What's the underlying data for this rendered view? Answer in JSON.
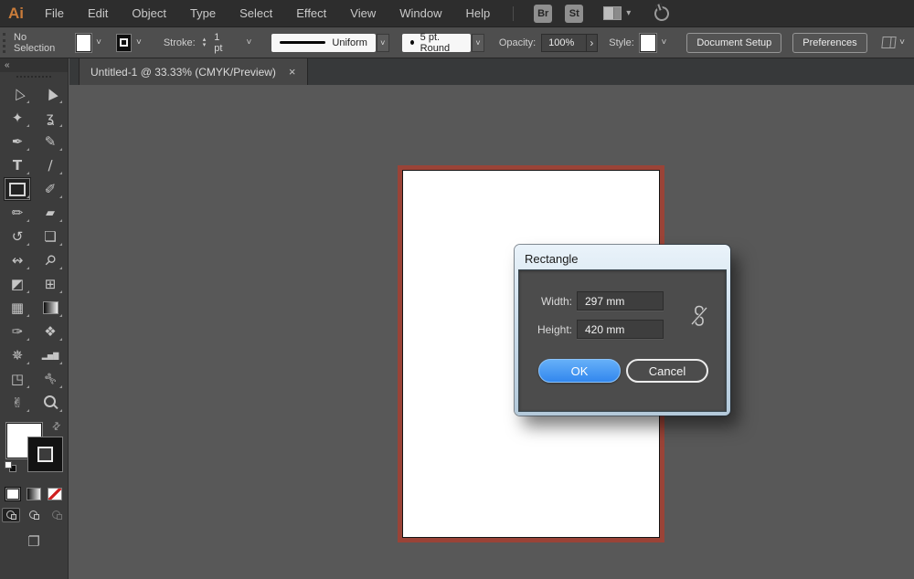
{
  "menubar": {
    "logo": "Ai",
    "items": [
      "File",
      "Edit",
      "Object",
      "Type",
      "Select",
      "Effect",
      "View",
      "Window",
      "Help"
    ],
    "bridge_badge": "Br",
    "stock_badge": "St"
  },
  "optionsbar": {
    "selection_status": "No Selection",
    "stroke_label": "Stroke:",
    "stroke_weight": "1 pt",
    "width_profile": "Uniform",
    "brush_definition": "5 pt. Round",
    "opacity_label": "Opacity:",
    "opacity_value": "100%",
    "style_label": "Style:",
    "document_setup_label": "Document Setup",
    "preferences_label": "Preferences"
  },
  "tabbar": {
    "title": "Untitled-1 @ 33.33% (CMYK/Preview)"
  },
  "toolbar": {
    "tools": [
      {
        "name": "selection-tool",
        "glyph": "▷",
        "cls": "rotUL big"
      },
      {
        "name": "direct-selection-tool",
        "glyph": "▶",
        "cls": "rotUL big"
      },
      {
        "name": "magic-wand-tool",
        "glyph": "✦",
        "cls": "big"
      },
      {
        "name": "lasso-tool",
        "glyph": "ʓ",
        "cls": "big"
      },
      {
        "name": "pen-tool",
        "glyph": "✒",
        "cls": "big"
      },
      {
        "name": "curvature-tool",
        "glyph": "✎",
        "cls": "big"
      },
      {
        "name": "type-tool",
        "glyph": "T",
        "cls": "bold"
      },
      {
        "name": "line-segment-tool",
        "glyph": "∕",
        "cls": "big"
      },
      {
        "name": "rectangle-tool",
        "glyph": "",
        "cls": "boxshape",
        "state": "selected"
      },
      {
        "name": "paintbrush-tool",
        "glyph": "✐",
        "cls": "big"
      },
      {
        "name": "shaper-tool",
        "glyph": "✏",
        "cls": "big"
      },
      {
        "name": "eraser-tool",
        "glyph": "▰",
        "cls": ""
      },
      {
        "name": "rotate-tool",
        "glyph": "↺",
        "cls": "big"
      },
      {
        "name": "scale-tool",
        "glyph": "❏",
        "cls": "big"
      },
      {
        "name": "width-tool",
        "glyph": "↭",
        "cls": "big"
      },
      {
        "name": "puppet-warp-tool",
        "glyph": "⚲",
        "cls": "big rot45"
      },
      {
        "name": "shape-builder-tool",
        "glyph": "◩",
        "cls": "big"
      },
      {
        "name": "perspective-grid-tool",
        "glyph": "⊞",
        "cls": "big"
      },
      {
        "name": "mesh-tool",
        "glyph": "▦",
        "cls": "big"
      },
      {
        "name": "gradient-tool",
        "glyph": "",
        "cls": "gradshape"
      },
      {
        "name": "eyedropper-tool",
        "glyph": "✑",
        "cls": "big"
      },
      {
        "name": "blend-tool",
        "glyph": "❖",
        "cls": "big"
      },
      {
        "name": "symbol-sprayer-tool",
        "glyph": "✵",
        "cls": "big"
      },
      {
        "name": "column-graph-tool",
        "glyph": "▂▅▇",
        "cls": "tiny"
      },
      {
        "name": "artboard-tool",
        "glyph": "◳",
        "cls": "big"
      },
      {
        "name": "slice-tool",
        "glyph": "✄",
        "cls": "big rot45"
      },
      {
        "name": "hand-tool",
        "glyph": "✌",
        "cls": "big"
      },
      {
        "name": "zoom-tool",
        "glyph": "",
        "cls": "mag"
      }
    ]
  },
  "dialog": {
    "title": "Rectangle",
    "width_label": "Width:",
    "width_value": "297 mm",
    "height_label": "Height:",
    "height_value": "420 mm",
    "ok_label": "OK",
    "cancel_label": "Cancel"
  },
  "glyphs": {
    "chevron": "˅",
    "menubar_chevron": "▾",
    "close": "×",
    "collapse": "«",
    "swap": "⇄",
    "screen_mode": "❐",
    "stepper_up": "▴",
    "stepper_down": "▾",
    "opacity_arrow": "›"
  },
  "colors": {
    "accent_blue": "#3f8fee",
    "artboard_frame": "#9a4337",
    "dialog_titlebar": "#cddeec",
    "panel_gray": "#4e4e4e",
    "canvas_gray": "#585858"
  }
}
